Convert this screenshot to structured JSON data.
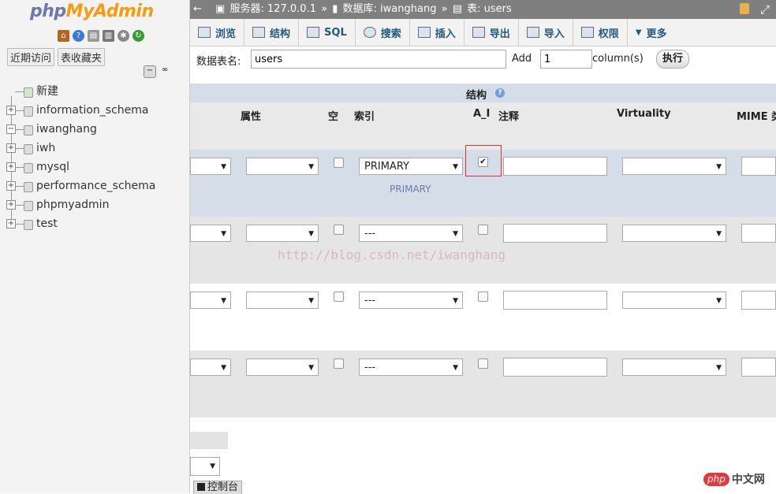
{
  "sidebar": {
    "logo": {
      "php": "php",
      "my": "My",
      "admin": "Admin"
    },
    "icons": [
      "home-icon",
      "help-icon",
      "docs-icon",
      "settings-icon",
      "reload-icon"
    ],
    "tabs": [
      "近期访问",
      "表收藏夹"
    ],
    "tree": [
      {
        "label": "新建",
        "type": "new"
      },
      {
        "label": "information_schema",
        "expander": "+"
      },
      {
        "label": "iwanghang",
        "expander": "−"
      },
      {
        "label": "iwh",
        "expander": "+"
      },
      {
        "label": "mysql",
        "expander": "+"
      },
      {
        "label": "performance_schema",
        "expander": "+"
      },
      {
        "label": "phpmyadmin",
        "expander": "+"
      },
      {
        "label": "test",
        "expander": "+"
      }
    ]
  },
  "breadcrumb": {
    "back": "←",
    "server": "服务器: 127.0.0.1",
    "sep1": "»",
    "database": "数据库: iwanghang",
    "sep2": "»",
    "table": "表: users",
    "maximize": "⤢"
  },
  "tabs": [
    "浏览",
    "结构",
    "SQL",
    "搜索",
    "插入",
    "导出",
    "导入",
    "权限",
    "更多"
  ],
  "name_row": {
    "table_name_label": "数据表名:",
    "table_name_value": "users",
    "add_label": "Add",
    "columns_value": "1",
    "columns_label": "column(s)",
    "go_label": "执行"
  },
  "structure": {
    "title": "结构",
    "columns": [
      "属性",
      "空",
      "索引",
      "A_I",
      "注释",
      "Virtuality",
      "MIME 类"
    ]
  },
  "rows": [
    {
      "index": "PRIMARY",
      "index_note": "PRIMARY",
      "ai_checked": true
    },
    {
      "index": "---",
      "index_note": "",
      "ai_checked": false
    },
    {
      "index": "---",
      "index_note": "",
      "ai_checked": false
    },
    {
      "index": "---",
      "index_note": "",
      "ai_checked": false
    }
  ],
  "watermark": "http://blog.csdn.net/iwanghang",
  "console_label": "控制台",
  "brand": {
    "pill": "php",
    "text": "中文网"
  },
  "colors": {
    "topbar": "#7f7f7f",
    "row_even": "#d5dde8",
    "row_odd": "#e5e5e5",
    "highlight": "#dd3333"
  }
}
